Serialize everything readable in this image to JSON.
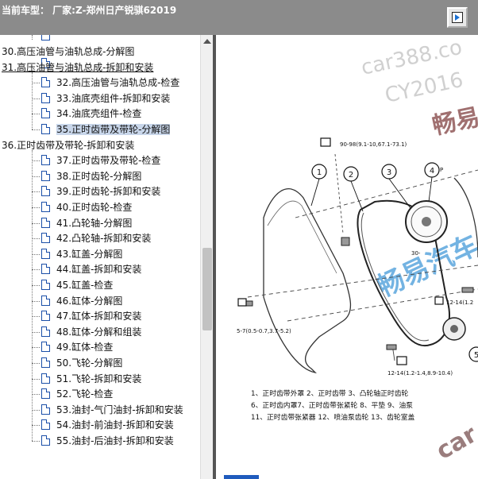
{
  "titlebar": {
    "text": "当前车型：  厂家:Z-郑州日产锐骐62019",
    "nav_button_icon": "next-page-icon"
  },
  "tree": {
    "items": [
      {
        "label": "30.高压油管与油轨总成-分解图",
        "level": 0
      },
      {
        "label": "31.高压油管与油轨总成-拆卸和安装",
        "level": 0,
        "underline": true
      },
      {
        "label": "32.高压油管与油轨总成-检查",
        "level": 1
      },
      {
        "label": "33.油底壳组件-拆卸和安装",
        "level": 1
      },
      {
        "label": "34.油底壳组件-检查",
        "level": 1
      },
      {
        "label": "35.正时齿带及带轮-分解图",
        "level": 1,
        "selected": true
      },
      {
        "label": "36.正时齿带及带轮-拆卸和安装",
        "level": 0
      },
      {
        "label": "37.正时齿带及带轮-检查",
        "level": 1
      },
      {
        "label": "38.正时齿轮-分解图",
        "level": 1
      },
      {
        "label": "39.正时齿轮-拆卸和安装",
        "level": 1
      },
      {
        "label": "40.正时齿轮-检查",
        "level": 1
      },
      {
        "label": "41.凸轮轴-分解图",
        "level": 1
      },
      {
        "label": "42.凸轮轴-拆卸和安装",
        "level": 1
      },
      {
        "label": "43.缸盖-分解图",
        "level": 1
      },
      {
        "label": "44.缸盖-拆卸和安装",
        "level": 1
      },
      {
        "label": "45.缸盖-检查",
        "level": 1
      },
      {
        "label": "46.缸体-分解图",
        "level": 1
      },
      {
        "label": "47.缸体-拆卸和安装",
        "level": 1
      },
      {
        "label": "48.缸体-分解和组装",
        "level": 1
      },
      {
        "label": "49.缸体-检查",
        "level": 1
      },
      {
        "label": "50.飞轮-分解图",
        "level": 1
      },
      {
        "label": "51.飞轮-拆卸和安装",
        "level": 1
      },
      {
        "label": "52.飞轮-检查",
        "level": 1
      },
      {
        "label": "53.油封-气门油封-拆卸和安装",
        "level": 1
      },
      {
        "label": "54.油封-前油封-拆卸和安装",
        "level": 1
      },
      {
        "label": "55.油封-后油封-拆卸和安装",
        "level": 1
      }
    ]
  },
  "diagram": {
    "watermarks": [
      "car388.co",
      "CY2016",
      "畅易",
      "畅易汽车",
      "car"
    ],
    "callouts": [
      "1",
      "2",
      "3",
      "4",
      "5"
    ],
    "torque_labels": [
      "90-98(9.1-10,67.1-73.1)",
      "5-7(0.5-0.7,3.7-5.2)",
      "12-14(1.2-1.4,8.9-10.4)",
      "30-",
      "12-14(1.2",
      "P"
    ],
    "legend_lines": [
      "1、正时齿带外罩  2、正时齿带  3、凸轮轴正时齿轮",
      "6、正时齿内罩7、正时齿带张紧轮  8、平垫  9、油泵",
      "11、正时齿带张紧器  12、喷油泵齿轮  13、齿轮室盖"
    ]
  }
}
